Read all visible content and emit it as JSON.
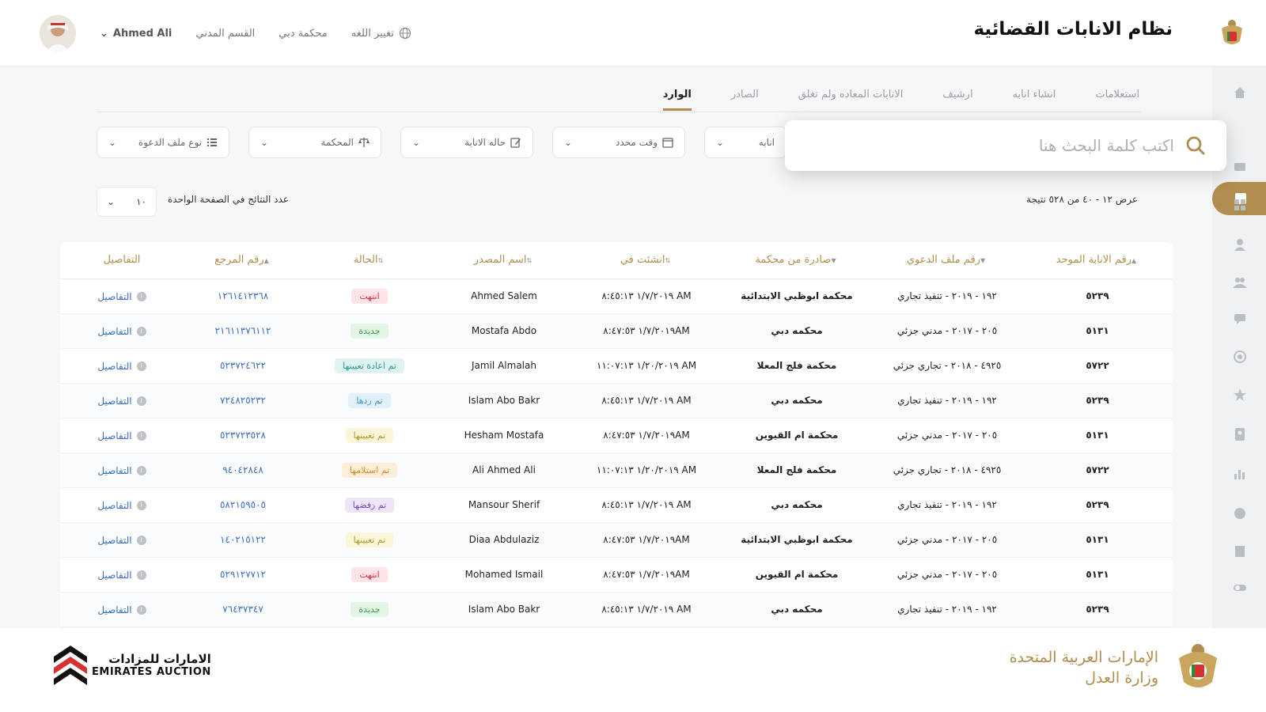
{
  "header": {
    "title": "نظام الانابات القضائية",
    "user_name": "Ahmed Ali",
    "nav": [
      "القسم المدني",
      "محكمة دبي"
    ],
    "language_label": "تغيير اللغه"
  },
  "tabs": [
    {
      "label": "الوارد",
      "active": true
    },
    {
      "label": "الصادر",
      "active": false
    },
    {
      "label": "الانابات المعاده ولم تغلق",
      "active": false
    },
    {
      "label": "ارشيف",
      "active": false
    },
    {
      "label": "انشاء انابه",
      "active": false
    },
    {
      "label": "استعلامات",
      "active": false
    }
  ],
  "search": {
    "placeholder": "اكتب كلمة البحث هنا"
  },
  "filters": {
    "inabah_partial": "انابه",
    "time": "وقت محدد",
    "status": "حاله الانابة",
    "court": "المحكمة",
    "case_type": "نوع ملف الدعوة"
  },
  "results": {
    "summary": "عرض ١٢ - ٤٠ من ٥٢٨ نتيجة",
    "per_page_label": "عدد النتائج في الصفحة الواحدة",
    "per_page_value": "١٠"
  },
  "table": {
    "columns": [
      "رقم الانابة الموحد",
      "رقم ملف الدعوي",
      "صادرة من محكمة",
      "انشئت في",
      "اسم المصدر",
      "الحالة",
      "رقم المرجع",
      "التفاصيل"
    ],
    "details_label": "التفاصيل",
    "rows": [
      {
        "id": "٥٢٣٩",
        "case": "١٩٢ - ٢٠١٩ - تنفيذ تجاري",
        "court": "محكمة ابوظبي الابتدائية",
        "created": "١/٧/٢٠١٩ ٨:٤٥:١٣ AM",
        "source": "Ahmed Salem",
        "status": "انتهت",
        "status_class": "b-ended",
        "ref": "١٢٦١٤١٢٣٦٨"
      },
      {
        "id": "٥١٣١",
        "case": "٢٠٥ - ٢٠١٧ - مدني جزئي",
        "court": "محكمه دبي",
        "created": "١/٧/٢٠١٩ ٨:٤٧:٥٣AM",
        "source": "Mostafa Abdo",
        "status": "جديدة",
        "status_class": "b-new",
        "ref": "٢١٦١١٣٧٦١١٢"
      },
      {
        "id": "٥٧٢٢",
        "case": "٤٩٢٥ - ٢٠١٨ - تجاري جزئي",
        "court": "محكمة فلج المعلا",
        "created": "١/٢٠/٢٠١٩ ١١:٠٧:١٣ AM",
        "source": "Jamil Almalah",
        "status": "تم اعادة تعيينها",
        "status_class": "b-reassigned",
        "ref": "٥٢٣٧٢٤٦٢٢"
      },
      {
        "id": "٥٢٣٩",
        "case": "١٩٢ - ٢٠١٩ - تنفيذ تجاري",
        "court": "محكمه دبي",
        "created": "١/٧/٢٠١٩ ٨:٤٥:١٣ AM",
        "source": "Islam Abo Bakr",
        "status": "تم ردها",
        "status_class": "b-replied",
        "ref": "٧٢٤٨٢٥٢٣٢"
      },
      {
        "id": "٥١٣١",
        "case": "٢٠٥ - ٢٠١٧ - مدني جزئي",
        "court": "محكمة ام القيوين",
        "created": "١/٧/٢٠١٩ ٨:٤٧:٥٣AM",
        "source": "Hesham Mostafa",
        "status": "تم تعيينها",
        "status_class": "b-assigned",
        "ref": "٥٢٣٧٢٣٥٢٨"
      },
      {
        "id": "٥٧٢٢",
        "case": "٤٩٢٥ - ٢٠١٨ - تجاري جزئي",
        "court": "محكمة فلج المعلا",
        "created": "١/٢٠/٢٠١٩ ١١:٠٧:١٣ AM",
        "source": "Ali Ahmed Ali",
        "status": "تم استلامها",
        "status_class": "b-received",
        "ref": "٩٤٠٤٢٨٤٨"
      },
      {
        "id": "٥٢٣٩",
        "case": "١٩٢ - ٢٠١٩ - تنفيذ تجاري",
        "court": "محكمه دبي",
        "created": "١/٧/٢٠١٩ ٨:٤٥:١٣ AM",
        "source": "Mansour Sherif",
        "status": "تم رفضها",
        "status_class": "b-rejected",
        "ref": "٥٨٢١٥٩٥٠٥"
      },
      {
        "id": "٥١٣١",
        "case": "٢٠٥ - ٢٠١٧ - مدني جزئي",
        "court": "محكمة ابوظبي الابتدائية",
        "created": "١/٧/٢٠١٩ ٨:٤٧:٥٣AM",
        "source": "Diaa Abdulaziz",
        "status": "تم تعيينها",
        "status_class": "b-assigned",
        "ref": "١٤٠٢١٥١٢٢"
      },
      {
        "id": "٥١٣١",
        "case": "٢٠٥ - ٢٠١٧ - مدني جزئي",
        "court": "محكمة ام القيوين",
        "created": "١/٧/٢٠١٩ ٨:٤٧:٥٣AM",
        "source": "Mohamed Ismail",
        "status": "انتهت",
        "status_class": "b-ended",
        "ref": "٥٢٩١٢٧٧١٢"
      },
      {
        "id": "٥٢٣٩",
        "case": "١٩٢ - ٢٠١٩ - تنفيذ تجاري",
        "court": "محكمه دبي",
        "created": "١/٧/٢٠١٩ ٨:٤٥:١٣ AM",
        "source": "Islam Abo Bakr",
        "status": "جديدة",
        "status_class": "b-new",
        "ref": "٧٦٤٣٧٣٤٧"
      }
    ]
  },
  "footer": {
    "moj_line1": "الإمارات العربية المتحدة",
    "moj_line2": "وزارة العدل",
    "ea_arabic": "الامارات للمزادات",
    "ea_english": "EMIRATES AUCTION"
  },
  "colors": {
    "accent": "#b08e4e",
    "link": "#3a6ec1"
  },
  "icons": [
    "globe-icon",
    "chevron-down-icon",
    "search-icon",
    "calendar-icon",
    "edit-icon",
    "scales-icon",
    "list-icon",
    "info-icon",
    "home-icon",
    "inbox-icon",
    "mail-icon",
    "grid-icon",
    "user-icon",
    "users-icon",
    "chat-icon",
    "target-icon",
    "star-icon",
    "contact-icon",
    "bar-chart-icon",
    "pie-icon",
    "building-icon",
    "toggle-icon"
  ]
}
